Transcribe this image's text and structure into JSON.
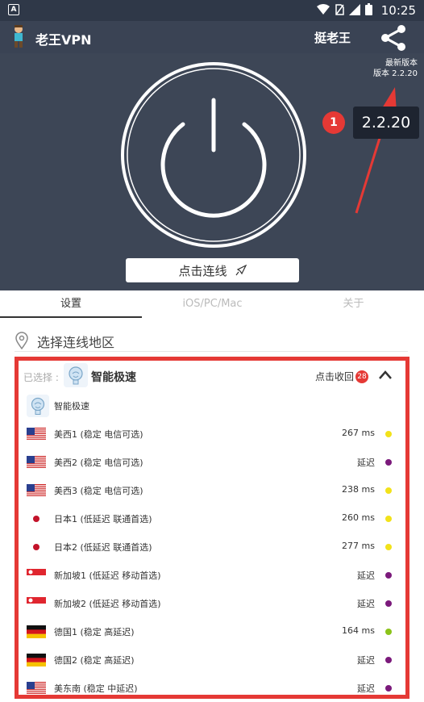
{
  "status_bar": {
    "time": "10:25"
  },
  "app_bar": {
    "title": "老王VPN",
    "user": "挺老王"
  },
  "version": {
    "line1": "最新版本",
    "line2": "版本 2.2.20"
  },
  "annotation": {
    "badge": "1",
    "tooltip": "2.2.20"
  },
  "connect_button": {
    "label": "点击连线"
  },
  "tabs": [
    {
      "label": "设置",
      "active": true
    },
    {
      "label": "iOS/PC/Mac",
      "active": false
    },
    {
      "label": "关于",
      "active": false
    }
  ],
  "region": {
    "label": "选择连线地区"
  },
  "selection": {
    "prefix": "已选择 :",
    "name": "智能极速",
    "collapse": "点击收回",
    "count": "28"
  },
  "servers": [
    {
      "name": "智能极速",
      "latency": "",
      "flag": "brain",
      "dot": ""
    },
    {
      "name": "美西1 (稳定 电信可选)",
      "latency": "267 ms",
      "flag": "us",
      "dot": "#f2e21a"
    },
    {
      "name": "美西2 (稳定 电信可选)",
      "latency": "延迟",
      "flag": "us",
      "dot": "#7b1a7b"
    },
    {
      "name": "美西3 (稳定 电信可选)",
      "latency": "238 ms",
      "flag": "us",
      "dot": "#f2e21a"
    },
    {
      "name": "日本1 (低延迟 联通首选)",
      "latency": "260 ms",
      "flag": "jp",
      "dot": "#f2e21a"
    },
    {
      "name": "日本2 (低延迟 联通首选)",
      "latency": "277 ms",
      "flag": "jp",
      "dot": "#f2e21a"
    },
    {
      "name": "新加坡1 (低延迟 移动首选)",
      "latency": "延迟",
      "flag": "sg",
      "dot": "#7b1a7b"
    },
    {
      "name": "新加坡2 (低延迟 移动首选)",
      "latency": "延迟",
      "flag": "sg",
      "dot": "#7b1a7b"
    },
    {
      "name": "德国1 (稳定 高延迟)",
      "latency": "164 ms",
      "flag": "de",
      "dot": "#8bc31a"
    },
    {
      "name": "德国2 (稳定 高延迟)",
      "latency": "延迟",
      "flag": "de",
      "dot": "#7b1a7b"
    },
    {
      "name": "美东南 (稳定 中延迟)",
      "latency": "延迟",
      "flag": "us",
      "dot": "#7b1a7b"
    }
  ],
  "colors": {
    "accent_red": "#e53935",
    "hero_bg": "#3d4656",
    "appbar_bg": "#3a4354"
  }
}
